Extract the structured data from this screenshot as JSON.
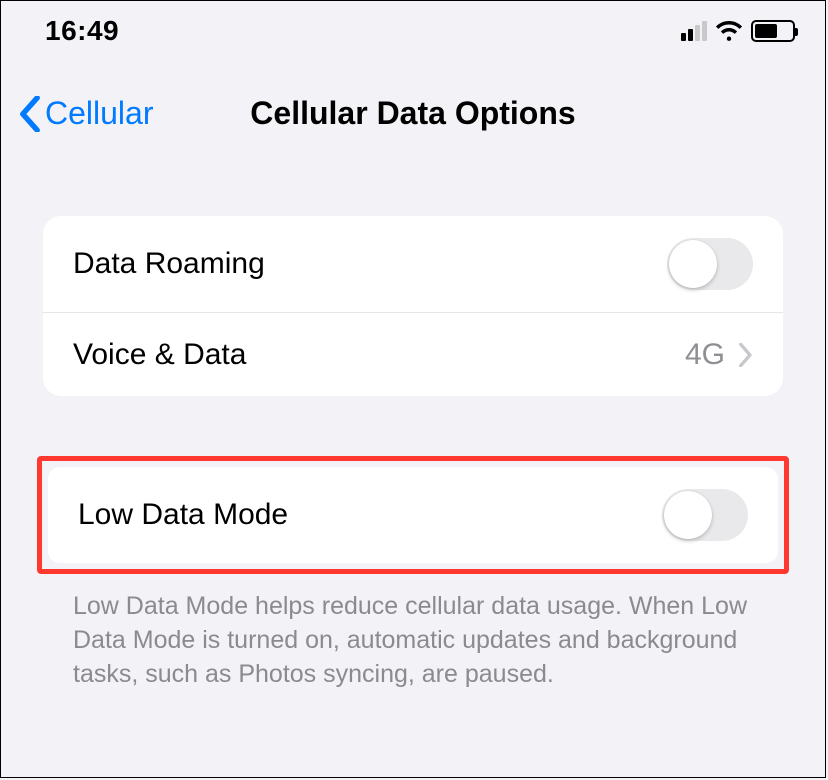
{
  "status": {
    "time": "16:49"
  },
  "nav": {
    "back_label": "Cellular",
    "title": "Cellular Data Options"
  },
  "group1": {
    "roaming": {
      "label": "Data Roaming",
      "on": false
    },
    "voice": {
      "label": "Voice & Data",
      "value": "4G"
    }
  },
  "group2": {
    "lowdata": {
      "label": "Low Data Mode",
      "on": false
    },
    "footer": "Low Data Mode helps reduce cellular data usage. When Low Data Mode is turned on, automatic updates and background tasks, such as Photos syncing, are paused."
  }
}
